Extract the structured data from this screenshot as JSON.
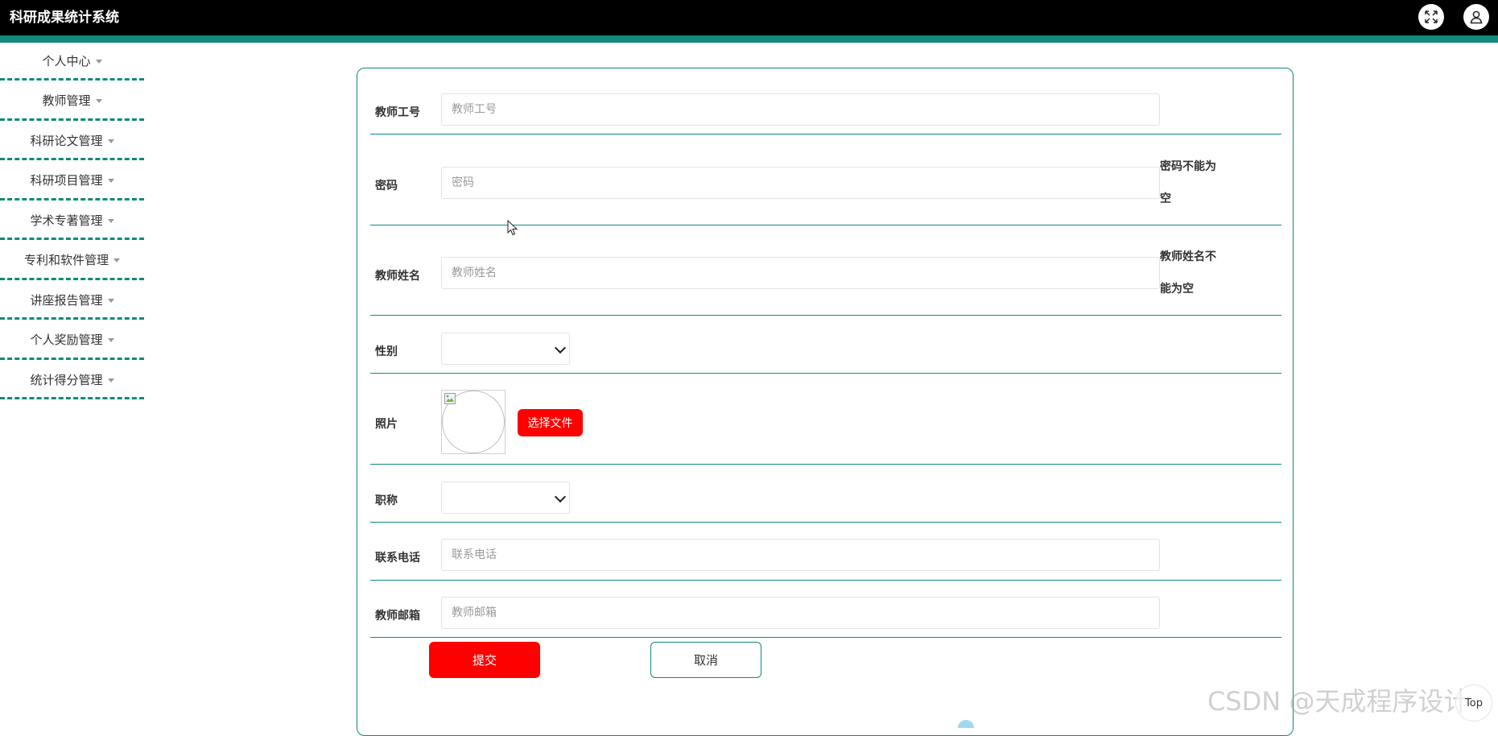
{
  "header": {
    "title": "科研成果统计系统",
    "icons": [
      "fullscreen-icon",
      "user-icon"
    ]
  },
  "sidebar": {
    "items": [
      {
        "label": "个人中心"
      },
      {
        "label": "教师管理"
      },
      {
        "label": "科研论文管理"
      },
      {
        "label": "科研项目管理"
      },
      {
        "label": "学术专著管理"
      },
      {
        "label": "专利和软件管理"
      },
      {
        "label": "讲座报告管理"
      },
      {
        "label": "个人奖励管理"
      },
      {
        "label": "统计得分管理"
      }
    ]
  },
  "form": {
    "teacher_id": {
      "label": "教师工号",
      "placeholder": "教师工号",
      "value": ""
    },
    "password": {
      "label": "密码",
      "placeholder": "密码",
      "value": "",
      "error_line1": "密码不能为",
      "error_line2": "空"
    },
    "teacher_name": {
      "label": "教师姓名",
      "placeholder": "教师姓名",
      "value": "",
      "error_line1": "教师姓名不",
      "error_line2": "能为空"
    },
    "gender": {
      "label": "性别",
      "value": ""
    },
    "photo": {
      "label": "照片",
      "button": "选择文件"
    },
    "title": {
      "label": "职称",
      "value": ""
    },
    "phone": {
      "label": "联系电话",
      "placeholder": "联系电话",
      "value": ""
    },
    "email": {
      "label": "教师邮箱",
      "placeholder": "教师邮箱",
      "value": ""
    },
    "submit": "提交",
    "cancel": "取消"
  },
  "colors": {
    "accent": "#0f8a7c",
    "primary_button": "#ff0000",
    "topbar": "#000000"
  },
  "overlay": {
    "watermark": "CSDN @天成程序设计",
    "top_button": "Top"
  }
}
